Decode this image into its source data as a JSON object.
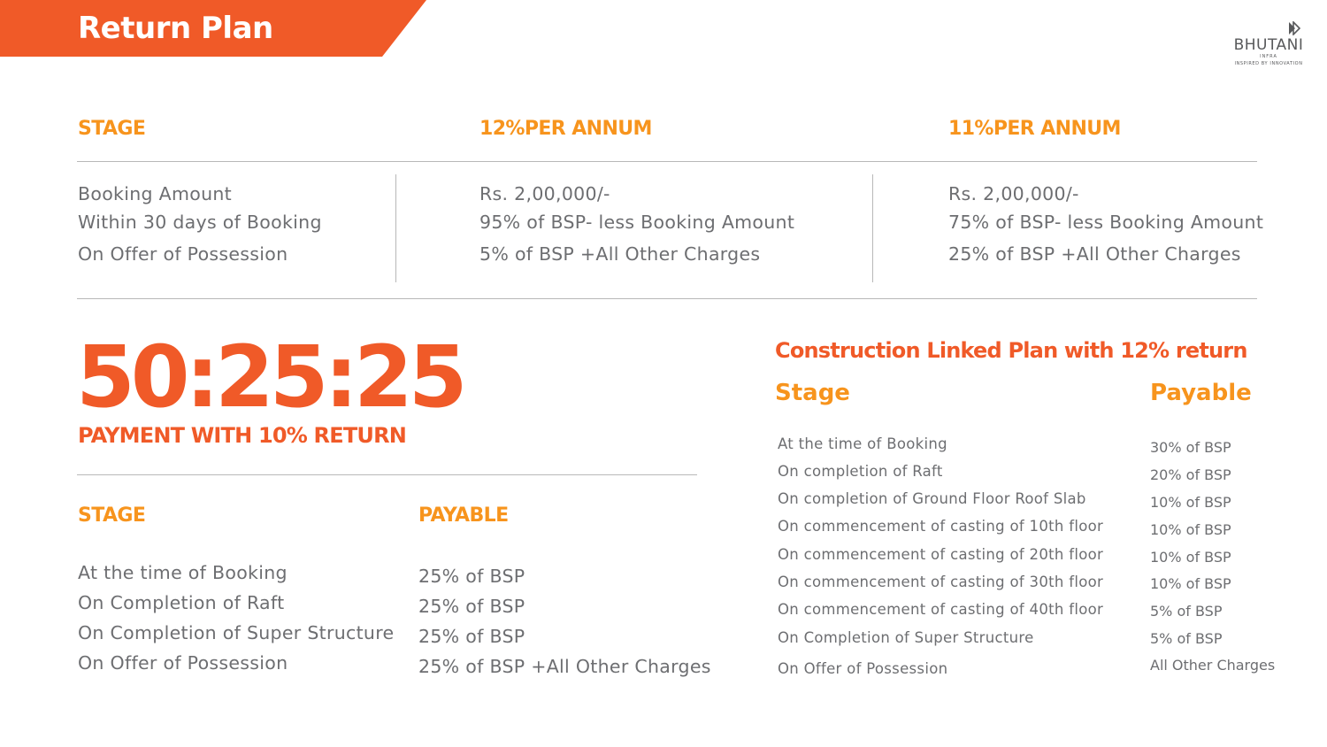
{
  "banner": {
    "title": "Return Plan"
  },
  "logo": {
    "name": "BHUTANI",
    "sub": "INFRA",
    "tagline": "INSPIRED BY INNOVATION"
  },
  "top_table": {
    "headers": [
      "STAGE",
      "12%PER ANNUM",
      "11%PER ANNUM"
    ],
    "stages": [
      "Booking Amount",
      "Within 30 days of Booking",
      "On Offer of Possession"
    ],
    "plan_12": [
      "Rs. 2,00,000/-",
      "95% of BSP- less Booking Amount",
      "5% of BSP +All Other Charges"
    ],
    "plan_11": [
      "Rs. 2,00,000/-",
      "75% of BSP- less Booking Amount",
      "25% of BSP +All Other Charges"
    ]
  },
  "ratio": {
    "value": "50:25:25",
    "caption": "PAYMENT WITH 10% RETURN"
  },
  "ratio_table": {
    "headers": [
      "STAGE",
      "PAYABLE"
    ],
    "stages": [
      "At the time of Booking",
      "On Completion of Raft",
      "On Completion of Super Structure",
      "On Offer of Possession"
    ],
    "payables": [
      "25% of BSP",
      "25% of BSP",
      "25% of BSP",
      "25% of BSP +All Other Charges"
    ]
  },
  "clp": {
    "title": "Construction Linked Plan with 12% return",
    "headers": [
      "Stage",
      "Payable"
    ],
    "stages": [
      "At the time of Booking",
      "On completion of Raft",
      "On completion of Ground Floor Roof Slab",
      "On commencement of casting of 10th floor",
      "On commencement of casting of 20th floor",
      "On commencement of casting of 30th floor",
      "On commencement of casting of 40th floor",
      "On Completion of Super Structure",
      "On Offer of Possession"
    ],
    "payables": [
      "30% of BSP",
      "20% of BSP",
      "10% of BSP",
      "10% of BSP",
      "10% of BSP",
      "10% of BSP",
      "5% of BSP",
      "5% of BSP",
      "All Other Charges"
    ]
  },
  "colors": {
    "orange_dark": "#f05a28",
    "orange_light": "#f7941d",
    "text_gray": "#6d6e71",
    "rule_gray": "#b8b8b8"
  }
}
